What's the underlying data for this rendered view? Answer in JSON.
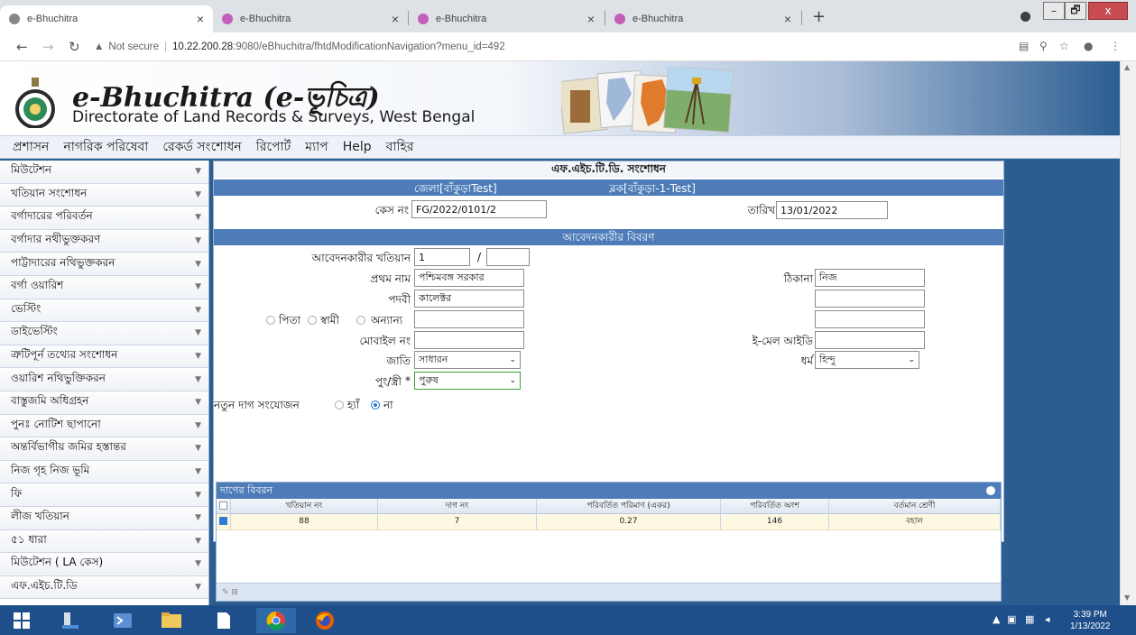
{
  "browser": {
    "tabs": [
      {
        "title": "e-Bhuchitra",
        "active": true
      },
      {
        "title": "e-Bhuchitra",
        "active": false
      },
      {
        "title": "e-Bhuchitra",
        "active": false
      },
      {
        "title": "e-Bhuchitra",
        "active": false
      }
    ],
    "close_glyph": "×",
    "new_tab_glyph": "+",
    "security_label": "Not secure",
    "url_host": "10.22.200.28",
    "url_rest": ":9080/eBhuchitra/fhtdModificationNavigation?menu_id=492",
    "window_buttons": {
      "minimize": "–",
      "maximize": "🗗",
      "close": "x"
    }
  },
  "site": {
    "title": "e-Bhuchitra (e-ভূচিত্র)",
    "subtitle": "Directorate of Land Records & Surveys, West Bengal"
  },
  "top_menu": [
    "প্রশাসন",
    "নাগরিক পরিষেবা",
    "রেকর্ড সংশোধন",
    "রিপোর্ট",
    "ম্যাপ",
    "Help",
    "বাহির"
  ],
  "left_nav": [
    "মিউটেশন",
    "খতিয়ান সংশোধন",
    "বর্গাদারের পরিবর্তন",
    "বর্গাদার নথীভুক্তকরণ",
    "পাট্টাদারের নথিভুক্তকরন",
    "বর্গা ওয়ারিশ",
    "ভেস্টিং",
    "ডাইভেস্টিং",
    "ত্রুটিপূর্ন তথ্যের সংশোধন",
    "ওয়ারিশ নথিভুক্তিকরন",
    "বাস্তুজমি অধিগ্রহন",
    "পুনঃ নোটিশ ছাপানো",
    "অন্তর্বিভাগীয় জমির হস্তান্তর",
    "নিজ গৃহ নিজ ভূমি",
    "ফি",
    "লীজ খতিয়ান",
    "৫১ ধারা",
    "মিউটেশন ( LA কেস)",
    "এফ.এইচ.টি.ডি"
  ],
  "form": {
    "title": "এফ.এইচ.টি.ডি. সংশোধন",
    "district": "জেলা[বাঁকুড়াTest]",
    "block": "ব্লক[বাঁকুড়া-1-Test]",
    "case_label": "কেস নং",
    "case_value": "FG/2022/0101/2",
    "date_label": "তারিখ",
    "date_value": "13/01/2022",
    "applicant_section": "আবেদনকারীর বিবরণ",
    "khatian_label": "আবেদনকারীর খতিয়ান",
    "khatian_value": "1",
    "khatian_sep": "/",
    "khatian_value2": "",
    "first_name_label": "প্রথম নাম",
    "first_name_value": "পশ্চিমবঙ্গ সরকার",
    "designation_label": "পদবী",
    "designation_value": "কালেক্টর",
    "relation_options": [
      "পিতা",
      "স্বামী",
      "অন্যান্য"
    ],
    "relation_value": "",
    "mobile_label": "মোবাইল নং",
    "mobile_value": "",
    "caste_label": "জাতি",
    "caste_value": "সাধারন",
    "gender_label": "পুং/স্ত্রী",
    "gender_required": "*",
    "gender_value": "পুরুষ",
    "address_label": "ঠিকানা",
    "address_line1": "নিজ",
    "address_line2": "",
    "address_line3": "",
    "email_label": "ই-মেল আইডি",
    "email_value": "",
    "religion_label": "ধর্ম",
    "religion_value": "হিন্দু",
    "new_plot_label": "নতুন দাগ সংযোজন",
    "yes_label": "হ্যাঁ",
    "no_label": "না",
    "new_plot_value": "না"
  },
  "grid": {
    "caption": "দাগের বিবরন",
    "headers": [
      "খতিয়ান নং",
      "দাগ নং",
      "পরিবর্তিত পরিমাণ (একর)",
      "পরিবর্তিত অংশ",
      "বর্তমান শ্রেণী"
    ],
    "rows": [
      {
        "checked": true,
        "cells": [
          "88",
          "7",
          "0.27",
          "146",
          "বহাল"
        ]
      }
    ],
    "footer_icons": "✎ ⊞"
  },
  "taskbar": {
    "time": "3:39 PM",
    "date": "1/13/2022"
  },
  "colors": {
    "page_bg": "#2b5d91",
    "section_bar": "#4d7cb8",
    "taskbar": "#1e4f8a"
  }
}
